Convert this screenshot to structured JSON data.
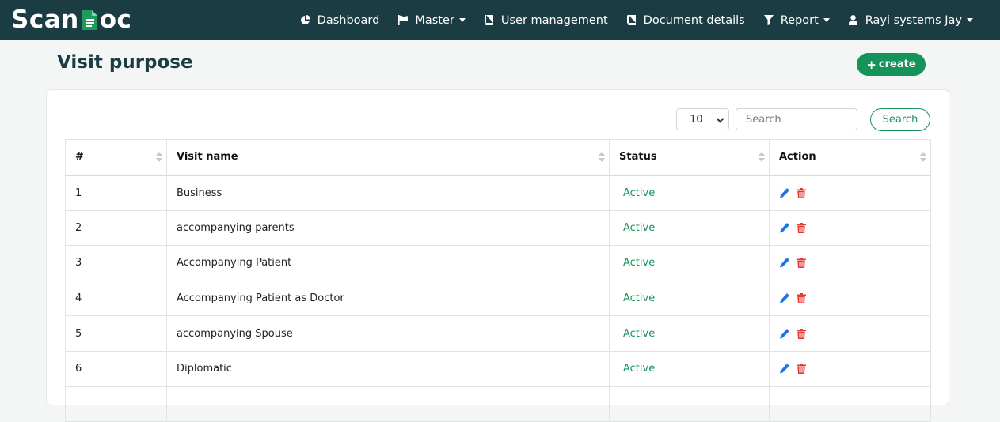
{
  "brand": {
    "name_before": "Scan",
    "name_after": "oc"
  },
  "nav": {
    "dashboard": "Dashboard",
    "master": "Master",
    "user_management": "User management",
    "document_details": "Document details",
    "report": "Report",
    "user": "Rayi systems Jay"
  },
  "page": {
    "title": "Visit purpose",
    "create_label": "create"
  },
  "controls": {
    "page_size": "10",
    "search_placeholder": "Search",
    "search_button": "Search"
  },
  "table": {
    "headers": {
      "index": "#",
      "visit_name": "Visit name",
      "status": "Status",
      "action": "Action"
    },
    "rows": [
      {
        "index": "1",
        "visit_name": "Business",
        "status": "Active"
      },
      {
        "index": "2",
        "visit_name": "accompanying parents",
        "status": "Active"
      },
      {
        "index": "3",
        "visit_name": "Accompanying Patient",
        "status": "Active"
      },
      {
        "index": "4",
        "visit_name": "Accompanying Patient as Doctor",
        "status": "Active"
      },
      {
        "index": "5",
        "visit_name": "accompanying Spouse",
        "status": "Active"
      },
      {
        "index": "6",
        "visit_name": "Diplomatic",
        "status": "Active"
      },
      {
        "index": "",
        "visit_name": "",
        "status": ""
      }
    ]
  },
  "colors": {
    "navbar": "#1c3c44",
    "accent_green": "#15935a",
    "edit_blue": "#1a73e8",
    "delete_red": "#e53935"
  }
}
